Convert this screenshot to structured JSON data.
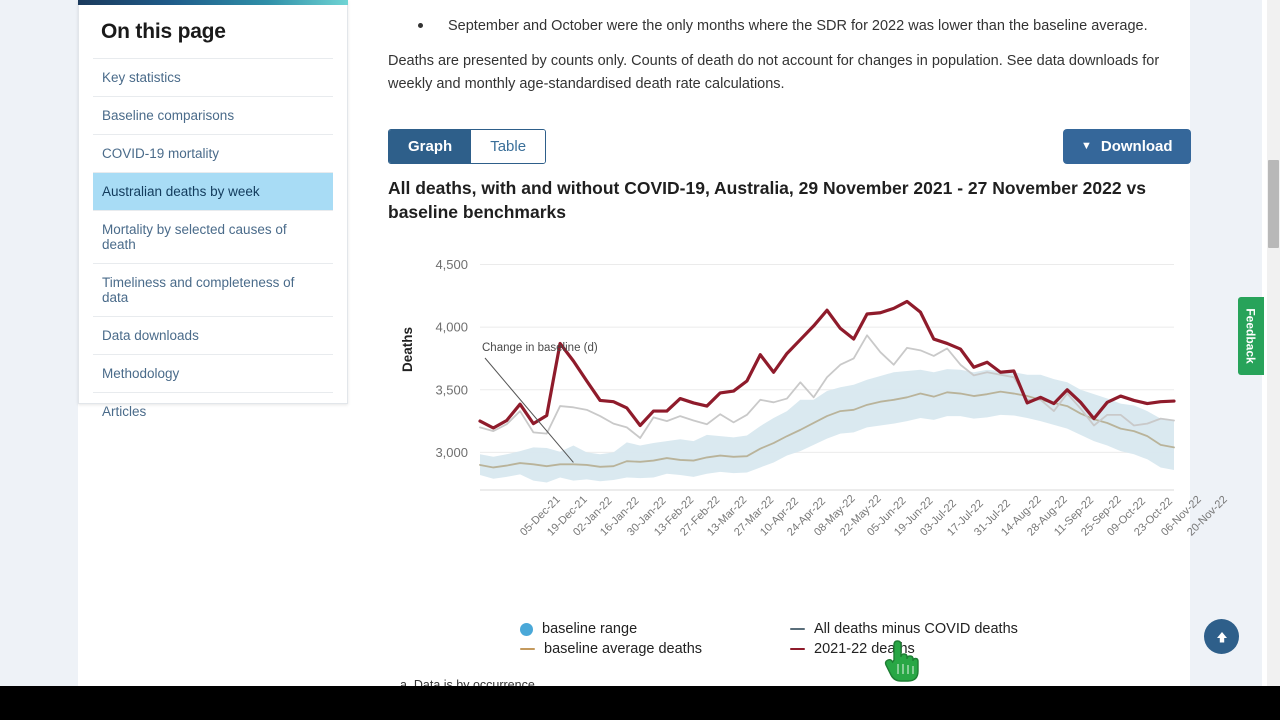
{
  "sidebar": {
    "title": "On this page",
    "items": [
      {
        "label": "Key statistics",
        "active": false
      },
      {
        "label": "Baseline comparisons",
        "active": false
      },
      {
        "label": "COVID-19 mortality",
        "active": false
      },
      {
        "label": "Australian deaths by week",
        "active": true
      },
      {
        "label": "Mortality by selected causes of death",
        "active": false
      },
      {
        "label": "Timeliness and completeness of data",
        "active": false
      },
      {
        "label": "Data downloads",
        "active": false
      },
      {
        "label": "Methodology",
        "active": false
      },
      {
        "label": "Articles",
        "active": false
      }
    ]
  },
  "main": {
    "bullet": "September and October were the only months where the SDR for 2022 was lower than the baseline average.",
    "paragraph": "Deaths are presented by counts only. Counts of death do not account for changes in population. See data downloads for weekly and monthly age-standardised death rate calculations.",
    "view_toggle": {
      "graph": "Graph",
      "table": "Table",
      "selected": "Graph"
    },
    "download_label": "Download",
    "footnote": "a. Data is by occurrence"
  },
  "right_rail": {
    "feedback_label": "Feedback",
    "scroll_top_icon": "arrow-up-icon"
  },
  "colors": {
    "accent_blue": "#2e5f8a",
    "active_nav": "#a8dcf5",
    "series_2021_22": "#8f1b2b",
    "series_minus_covid": "#c9c9c9",
    "baseline_average": "#b9b39a",
    "baseline_range": "#d8e8ef",
    "feedback_green": "#27a35a"
  },
  "chart_data": {
    "type": "line",
    "title": "All deaths, with and without COVID-19, Australia, 29 November 2021 - 27 November 2022 vs baseline benchmarks",
    "xlabel": "",
    "ylabel": "Deaths",
    "ylim": [
      2700,
      4600
    ],
    "yticks": [
      3000,
      3500,
      4000,
      4500
    ],
    "ytick_labels": [
      "3,000",
      "3,500",
      "4,000",
      "4,500"
    ],
    "grid": true,
    "legend_position": "bottom",
    "annotation": {
      "text": "Change in baseline (d)",
      "x_index": 7,
      "y": 2920
    },
    "x": [
      "29-Nov-21",
      "06-Dec-21",
      "13-Dec-21",
      "20-Dec-21",
      "27-Dec-21",
      "03-Jan-22",
      "10-Jan-22",
      "17-Jan-22",
      "24-Jan-22",
      "31-Jan-22",
      "07-Feb-22",
      "14-Feb-22",
      "21-Feb-22",
      "28-Feb-22",
      "07-Mar-22",
      "14-Mar-22",
      "21-Mar-22",
      "28-Mar-22",
      "04-Apr-22",
      "11-Apr-22",
      "18-Apr-22",
      "25-Apr-22",
      "02-May-22",
      "09-May-22",
      "16-May-22",
      "23-May-22",
      "30-May-22",
      "06-Jun-22",
      "13-Jun-22",
      "20-Jun-22",
      "27-Jun-22",
      "04-Jul-22",
      "11-Jul-22",
      "18-Jul-22",
      "25-Jul-22",
      "01-Aug-22",
      "08-Aug-22",
      "15-Aug-22",
      "22-Aug-22",
      "29-Aug-22",
      "05-Sep-22",
      "12-Sep-22",
      "19-Sep-22",
      "26-Sep-22",
      "03-Oct-22",
      "10-Oct-22",
      "17-Oct-22",
      "24-Oct-22",
      "31-Oct-22",
      "07-Nov-22",
      "14-Nov-22",
      "21-Nov-22",
      "27-Nov-22"
    ],
    "xtick_labels": [
      "05-Dec-21",
      "19-Dec-21",
      "02-Jan-22",
      "16-Jan-22",
      "30-Jan-22",
      "13-Feb-22",
      "27-Feb-22",
      "13-Mar-22",
      "27-Mar-22",
      "10-Apr-22",
      "24-Apr-22",
      "08-May-22",
      "22-May-22",
      "05-Jun-22",
      "19-Jun-22",
      "03-Jul-22",
      "17-Jul-22",
      "31-Jul-22",
      "14-Aug-22",
      "28-Aug-22",
      "11-Sep-22",
      "25-Sep-22",
      "09-Oct-22",
      "23-Oct-22",
      "06-Nov-22",
      "20-Nov-22"
    ],
    "series": [
      {
        "name": "2021-22 deaths",
        "color": "#8f1b2b",
        "width": 3.2,
        "values": [
          3250,
          3195,
          3255,
          3385,
          3230,
          3295,
          3870,
          3730,
          3570,
          3415,
          3405,
          3355,
          3215,
          3330,
          3330,
          3430,
          3395,
          3370,
          3475,
          3490,
          3570,
          3780,
          3640,
          3790,
          3900,
          4010,
          4135,
          3990,
          3905,
          4105,
          4115,
          4150,
          4205,
          4120,
          3905,
          3870,
          3825,
          3680,
          3720,
          3640,
          3650,
          3395,
          3440,
          3390,
          3500,
          3400,
          3270,
          3400,
          3450,
          3415,
          3390,
          3405,
          3410
        ]
      },
      {
        "name": "All deaths minus COVID deaths",
        "color": "#c9c9c9",
        "width": 1.8,
        "values": [
          3200,
          3170,
          3225,
          3330,
          3160,
          3150,
          3370,
          3360,
          3340,
          3290,
          3230,
          3200,
          3115,
          3280,
          3250,
          3290,
          3255,
          3225,
          3305,
          3240,
          3300,
          3420,
          3400,
          3430,
          3560,
          3440,
          3600,
          3700,
          3750,
          3935,
          3800,
          3700,
          3835,
          3815,
          3770,
          3830,
          3700,
          3615,
          3640,
          3620,
          3600,
          3420,
          3420,
          3330,
          3470,
          3350,
          3215,
          3300,
          3300,
          3215,
          3230,
          3270,
          3255
        ]
      },
      {
        "name": "baseline average deaths",
        "color": "#b9b39a",
        "width": 1.8,
        "values": [
          2900,
          2880,
          2895,
          2915,
          2905,
          2890,
          2905,
          2905,
          2900,
          2885,
          2890,
          2930,
          2925,
          2935,
          2955,
          2940,
          2935,
          2960,
          2975,
          2965,
          2970,
          3030,
          3075,
          3130,
          3180,
          3235,
          3290,
          3330,
          3340,
          3380,
          3405,
          3420,
          3440,
          3470,
          3445,
          3480,
          3470,
          3450,
          3465,
          3485,
          3470,
          3450,
          3420,
          3395,
          3370,
          3310,
          3265,
          3235,
          3190,
          3170,
          3130,
          3060,
          3040
        ]
      }
    ],
    "band": {
      "name": "baseline range",
      "color": "#d8e8ef",
      "upper": [
        2985,
        2965,
        2985,
        3010,
        3040,
        3035,
        3005,
        3055,
        3000,
        2985,
        3000,
        3080,
        3055,
        3075,
        3090,
        3105,
        3090,
        3140,
        3130,
        3120,
        3135,
        3210,
        3275,
        3330,
        3420,
        3420,
        3490,
        3520,
        3540,
        3580,
        3610,
        3640,
        3650,
        3660,
        3640,
        3665,
        3660,
        3640,
        3660,
        3650,
        3640,
        3620,
        3620,
        3585,
        3560,
        3500,
        3465,
        3430,
        3390,
        3375,
        3330,
        3270,
        3250
      ],
      "lower": [
        2820,
        2790,
        2805,
        2825,
        2775,
        2760,
        2800,
        2775,
        2785,
        2770,
        2780,
        2800,
        2795,
        2800,
        2830,
        2820,
        2805,
        2830,
        2845,
        2835,
        2840,
        2880,
        2920,
        2975,
        3010,
        3060,
        3110,
        3150,
        3160,
        3200,
        3215,
        3230,
        3250,
        3275,
        3260,
        3290,
        3290,
        3270,
        3280,
        3300,
        3295,
        3275,
        3250,
        3220,
        3190,
        3140,
        3090,
        3055,
        3010,
        2985,
        2945,
        2880,
        2860
      ]
    },
    "legend": [
      {
        "label": "baseline range",
        "marker": "dot",
        "color": "#4aa8d8"
      },
      {
        "label": "baseline average deaths",
        "marker": "line",
        "color": "#c49a5e"
      },
      {
        "label": "All deaths minus COVID deaths",
        "marker": "line",
        "color": "#5a6e7a"
      },
      {
        "label": "2021-22 deaths",
        "marker": "line",
        "color": "#8f1b2b"
      }
    ]
  }
}
